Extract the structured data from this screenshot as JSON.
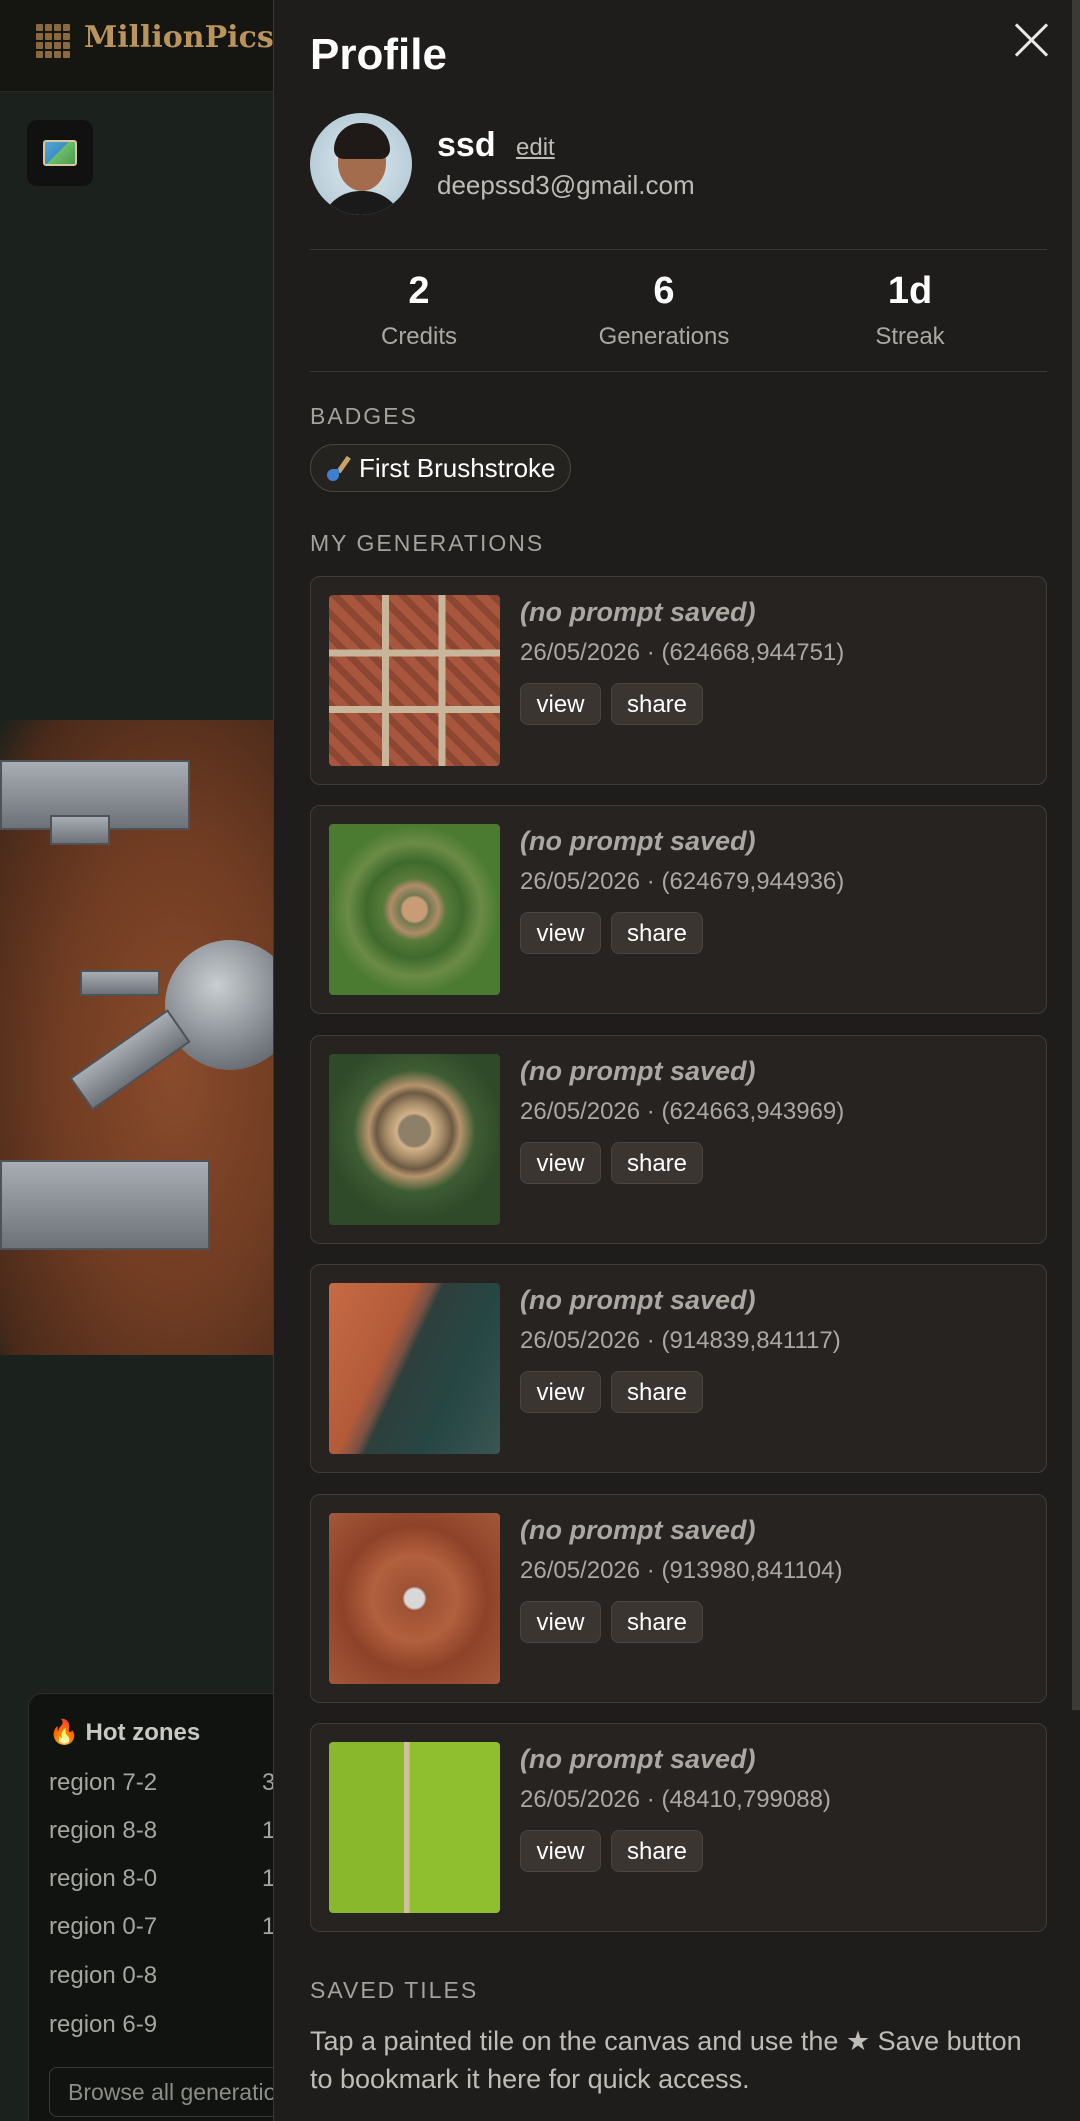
{
  "app": {
    "logo_text": "MillionPicsC"
  },
  "hot_zones": {
    "title": "🔥 Hot zones",
    "rows": [
      {
        "label": "region 7-2",
        "count": "3"
      },
      {
        "label": "region 8-8",
        "count": "1"
      },
      {
        "label": "region 8-0",
        "count": "1"
      },
      {
        "label": "region 0-7",
        "count": "1"
      },
      {
        "label": "region 0-8",
        "count": ""
      },
      {
        "label": "region 6-9",
        "count": ""
      }
    ],
    "browse_label": "Browse all generations"
  },
  "profile": {
    "title": "Profile",
    "username": "ssd",
    "edit_label": "edit",
    "email": "deepssd3@gmail.com",
    "stats": [
      {
        "value": "2",
        "label": "Credits"
      },
      {
        "value": "6",
        "label": "Generations"
      },
      {
        "value": "1d",
        "label": "Streak"
      }
    ],
    "badges_heading": "BADGES",
    "badges": [
      {
        "label": "First Brushstroke",
        "icon": "paintbrush-icon"
      }
    ],
    "generations_heading": "MY GENERATIONS",
    "generations": [
      {
        "prompt": "(no prompt saved)",
        "meta": "26/05/2026 · (624668,944751)",
        "view_label": "view",
        "share_label": "share"
      },
      {
        "prompt": "(no prompt saved)",
        "meta": "26/05/2026 · (624679,944936)",
        "view_label": "view",
        "share_label": "share"
      },
      {
        "prompt": "(no prompt saved)",
        "meta": "26/05/2026 · (624663,943969)",
        "view_label": "view",
        "share_label": "share"
      },
      {
        "prompt": "(no prompt saved)",
        "meta": "26/05/2026 · (914839,841117)",
        "view_label": "view",
        "share_label": "share"
      },
      {
        "prompt": "(no prompt saved)",
        "meta": "26/05/2026 · (913980,841104)",
        "view_label": "view",
        "share_label": "share"
      },
      {
        "prompt": "(no prompt saved)",
        "meta": "26/05/2026 · (48410,799088)",
        "view_label": "view",
        "share_label": "share"
      }
    ],
    "saved_heading": "SAVED TILES",
    "saved_text": "Tap a painted tile on the canvas and use the ★ Save button to bookmark it here for quick access."
  },
  "colors": {
    "panel_bg": "#1e1d1b",
    "card_bg": "#262320",
    "button_bg": "#3a3530",
    "brand": "#b9945c"
  }
}
